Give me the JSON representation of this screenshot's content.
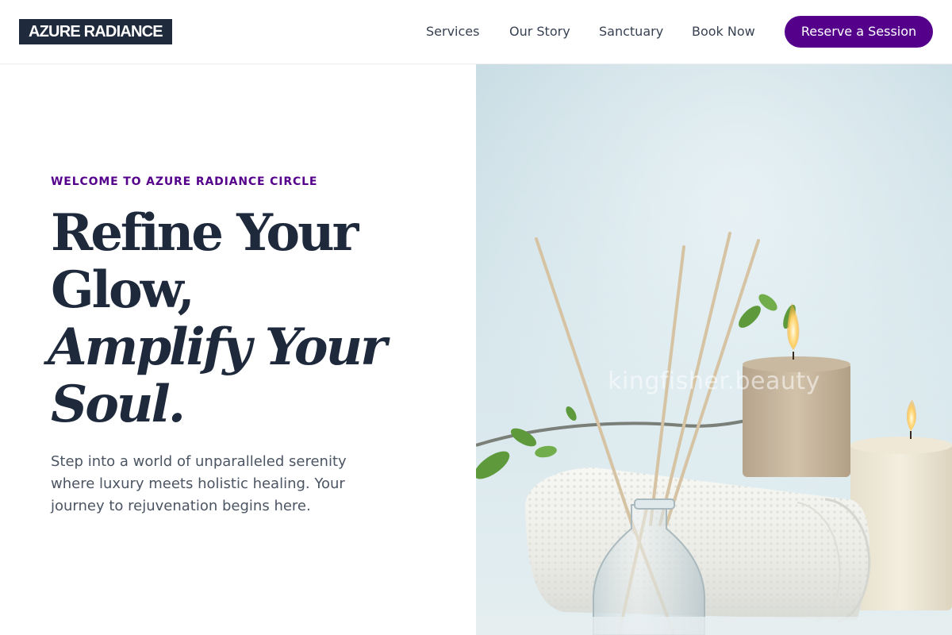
{
  "header": {
    "logo_text": "AZURE RADIANCE",
    "nav": [
      {
        "label": "Services"
      },
      {
        "label": "Our Story"
      },
      {
        "label": "Sanctuary"
      },
      {
        "label": "Book Now"
      }
    ],
    "cta_label": "Reserve a Session"
  },
  "hero": {
    "eyebrow": "WELCOME TO AZURE RADIANCE CIRCLE",
    "headline": {
      "line1": "Refine Your",
      "line2": "Glow,",
      "line3": "Amplify Your",
      "line4": "Soul."
    },
    "subtext": "Step into a world of unparalleled serenity where luxury meets holistic healing. Your journey to rejuvenation begins here.",
    "image": {
      "subject": "spa scene with reed diffuser, rolled white towel, lit candles and green leaves",
      "watermark": "kingfisher.beauty"
    }
  },
  "colors": {
    "accent": "#54008b",
    "logo_bg": "#1f2a3c",
    "heading": "#1e293b",
    "body_text": "#4b5563"
  }
}
